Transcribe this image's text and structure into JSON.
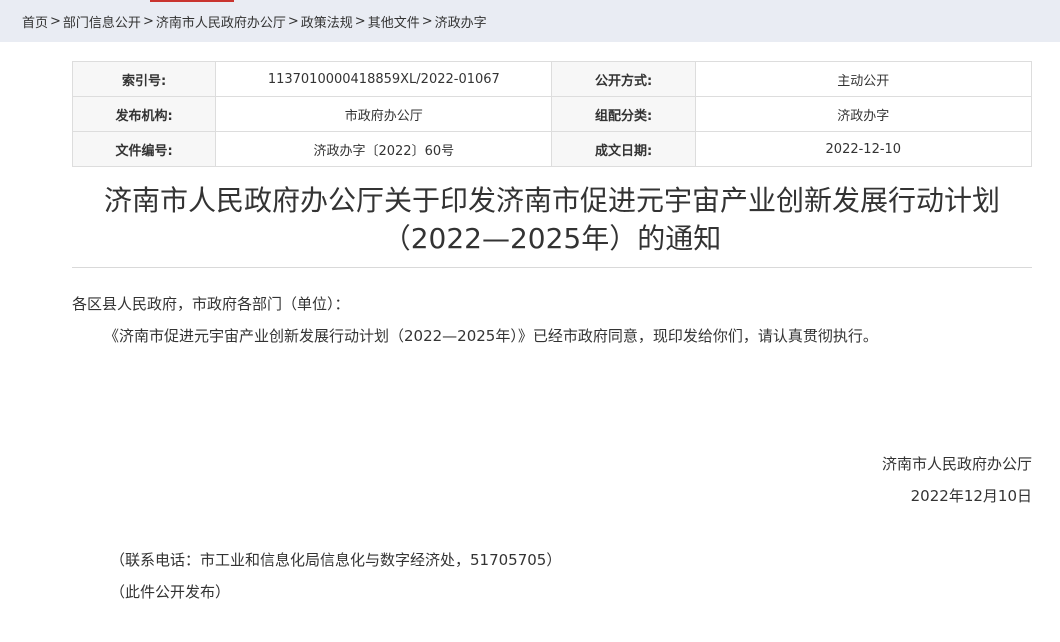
{
  "breadcrumb": {
    "items": [
      "首页",
      "部门信息公开",
      "济南市人民政府办公厅",
      "政策法规",
      "其他文件",
      "济政办字"
    ],
    "separator": ">"
  },
  "meta": {
    "index_label": "索引号:",
    "index_value": "1137010000418859XL/2022-01067",
    "disclosure_label": "公开方式:",
    "disclosure_value": "主动公开",
    "publisher_label": "发布机构:",
    "publisher_value": "市政府办公厅",
    "category_label": "组配分类:",
    "category_value": "济政办字",
    "docno_label": "文件编号:",
    "docno_value": "济政办字〔2022〕60号",
    "date_label": "成文日期:",
    "date_value": "2022-12-10"
  },
  "document": {
    "title_line1": "济南市人民政府办公厅关于印发济南市促进元宇宙产业创新发展行动计划",
    "title_line2": "（2022—2025年）的通知",
    "salutation": "各区县人民政府，市政府各部门（单位）：",
    "body": "《济南市促进元宇宙产业创新发展行动计划（2022—2025年）》已经市政府同意，现印发给你们，请认真贯彻执行。",
    "signature": "济南市人民政府办公厅",
    "sign_date": "2022年12月10日",
    "contact": "（联系电话：市工业和信息化局信息化与数字经济处，51705705）",
    "publish_note": "（此件公开发布）"
  },
  "colors": {
    "breadcrumb_bg": "#e9ecf3",
    "accent": "#c9342f",
    "label_bg": "#f7f7f7",
    "border": "#dddddd"
  }
}
